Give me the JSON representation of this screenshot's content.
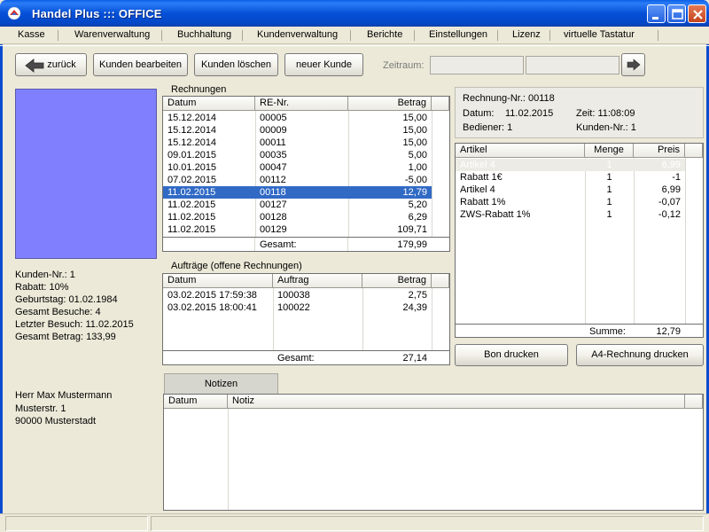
{
  "window": {
    "title": "Handel Plus ::: OFFICE"
  },
  "menu": [
    {
      "label": "Kasse"
    },
    {
      "label": "Warenverwaltung"
    },
    {
      "label": "Buchhaltung"
    },
    {
      "label": "Kundenverwaltung"
    },
    {
      "label": "Berichte"
    },
    {
      "label": "Einstellungen"
    },
    {
      "label": "Lizenz"
    },
    {
      "label": "virtuelle Tastatur"
    }
  ],
  "toolbar": {
    "back_label": "zurück",
    "edit_label": "Kunden bearbeiten",
    "delete_label": "Kunden löschen",
    "new_label": "neuer Kunde",
    "period_label": "Zeitraum:",
    "period_from": "",
    "period_to": ""
  },
  "customer": {
    "info": [
      "Kunden-Nr.: 1",
      "Rabatt: 10%",
      "Geburtstag: 01.02.1984",
      "Gesamt Besuche: 4",
      "Letzter Besuch: 11.02.2015",
      "Gesamt Betrag: 133,99"
    ],
    "address": [
      "Herr Max Mustermann",
      "Musterstr. 1",
      "90000 Musterstadt"
    ]
  },
  "invoices": {
    "label": "Rechnungen",
    "headers": [
      "Datum",
      "RE-Nr.",
      "Betrag"
    ],
    "rows": [
      [
        "15.12.2014",
        "00005",
        "15,00"
      ],
      [
        "15.12.2014",
        "00009",
        "15,00"
      ],
      [
        "15.12.2014",
        "00011",
        "15,00"
      ],
      [
        "09.01.2015",
        "00035",
        "5,00"
      ],
      [
        "10.01.2015",
        "00047",
        "1,00"
      ],
      [
        "07.02.2015",
        "00112",
        "-5,00"
      ],
      [
        "11.02.2015",
        "00118",
        "12,79"
      ],
      [
        "11.02.2015",
        "00127",
        "5,20"
      ],
      [
        "11.02.2015",
        "00128",
        "6,29"
      ],
      [
        "11.02.2015",
        "00129",
        "109,71"
      ]
    ],
    "selected_index": 6,
    "total_label": "Gesamt:",
    "total_value": "179,99"
  },
  "orders": {
    "label": "Aufträge (offene Rechnungen)",
    "headers": [
      "Datum",
      "Auftrag",
      "Betrag"
    ],
    "rows": [
      [
        "03.02.2015 17:59:38",
        "100038",
        "2,75"
      ],
      [
        "03.02.2015 18:00:41",
        "100022",
        "24,39"
      ]
    ],
    "total_label": "Gesamt:",
    "total_value": "27,14"
  },
  "invoice_detail": {
    "number": "Rechnung-Nr.: 00118",
    "date_label": "Datum:",
    "date_value": "11.02.2015",
    "time": "Zeit: 11:08:09",
    "operator": "Bediener: 1",
    "customer_no": "Kunden-Nr.: 1"
  },
  "items": {
    "headers": [
      "Artikel",
      "Menge",
      "Preis"
    ],
    "rows": [
      [
        "Artikel 4",
        "1",
        "6,99"
      ],
      [
        "Rabatt 1€",
        "1",
        "-1"
      ],
      [
        "Artikel 4",
        "1",
        "6,99"
      ],
      [
        "Rabatt 1%",
        "1",
        "-0,07"
      ],
      [
        "ZWS-Rabatt 1%",
        "1",
        "-0,12"
      ]
    ],
    "sum_label": "Summe:",
    "sum_value": "12,79"
  },
  "actions": {
    "bon_label": "Bon drucken",
    "a4_label": "A4-Rechnung drucken"
  },
  "notes": {
    "tab_label": "Notizen",
    "headers": [
      "Datum",
      "Notiz"
    ]
  },
  "colors": {
    "photo_bg": "#8080ff",
    "selection": "#316ac5",
    "titlebar": "#0550d8"
  }
}
